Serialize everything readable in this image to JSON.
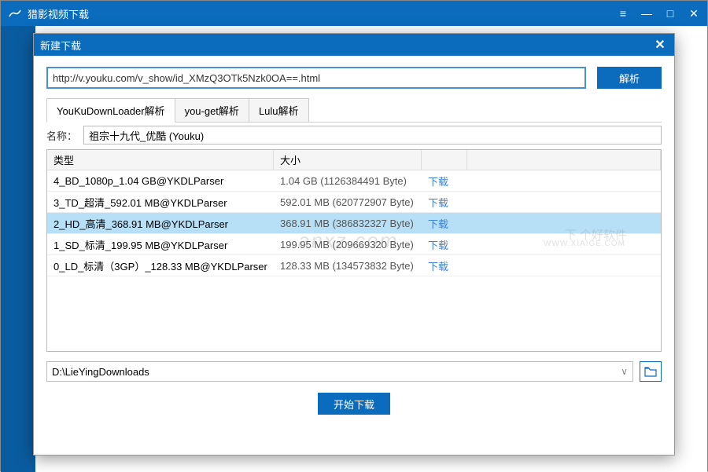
{
  "main_window": {
    "title": "猎影视频下载"
  },
  "modal": {
    "title": "新建下载",
    "url": "http://v.youku.com/v_show/id_XMzQ3OTk5Nzk0OA==.html",
    "parse_btn": "解析",
    "tabs": [
      "YouKuDownLoader解析",
      "you-get解析",
      "Lulu解析"
    ],
    "name_label": "名称：",
    "name_value": "祖宗十九代_优酷 (Youku)",
    "table": {
      "headers": {
        "type": "类型",
        "size": "大小"
      },
      "rows": [
        {
          "type": "4_BD_1080p_1.04 GB@YKDLParser",
          "size": "1.04 GB (1126384491 Byte)",
          "action": "下载",
          "selected": false
        },
        {
          "type": "3_TD_超清_592.01 MB@YKDLParser",
          "size": "592.01 MB (620772907 Byte)",
          "action": "下载",
          "selected": false
        },
        {
          "type": "2_HD_高清_368.91 MB@YKDLParser",
          "size": "368.91 MB (386832327 Byte)",
          "action": "下载",
          "selected": true
        },
        {
          "type": "1_SD_标清_199.95 MB@YKDLParser",
          "size": "199.95 MB (209669320 Byte)",
          "action": "下载",
          "selected": false
        },
        {
          "type": "0_LD_标清（3GP）_128.33 MB@YKDLParser",
          "size": "128.33 MB (134573832 Byte)",
          "action": "下载",
          "selected": false
        }
      ]
    },
    "path": "D:\\LieYingDownloads",
    "start_btn": "开始下载"
  },
  "watermark": {
    "w1": "anxz.com",
    "w2": "下 个好软件",
    "w3": "WWW.XIAIGE.COM"
  }
}
